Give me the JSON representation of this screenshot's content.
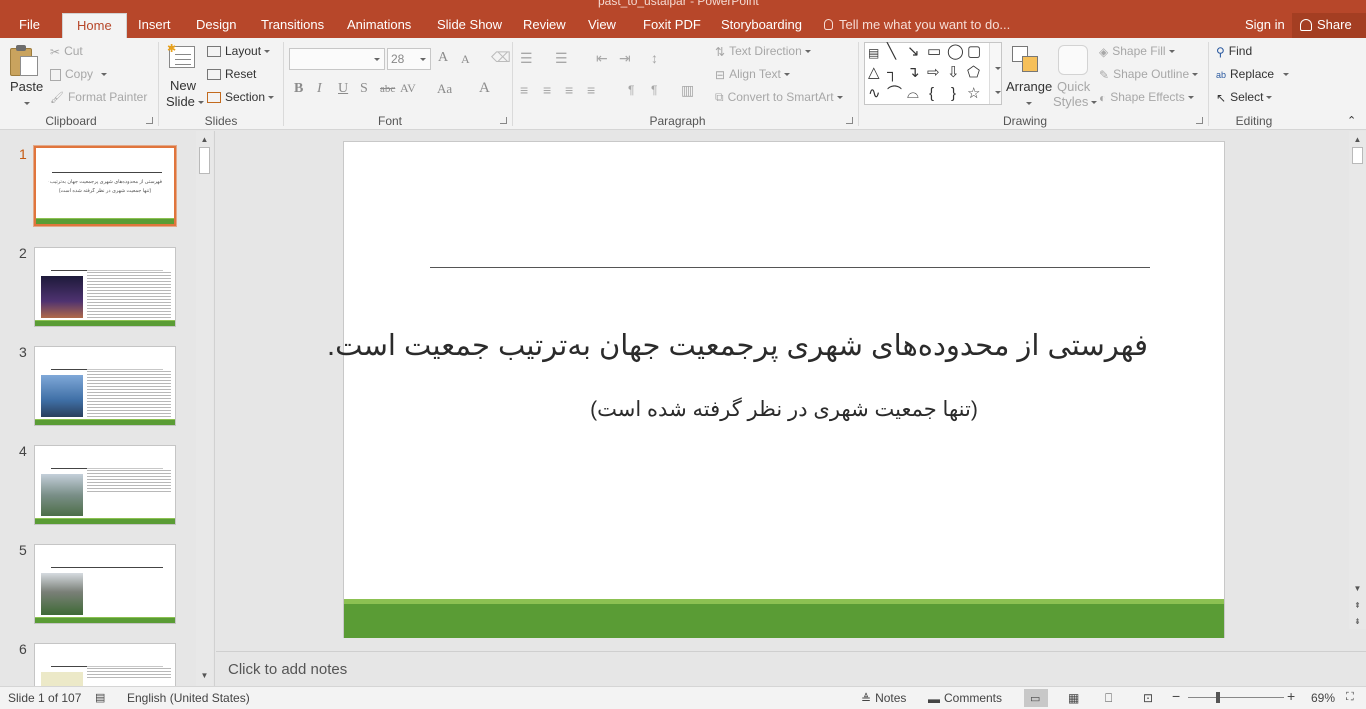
{
  "window": {
    "title": "past_to_ustaipar - PowerPoint"
  },
  "tabs": [
    {
      "label": "File",
      "active": false
    },
    {
      "label": "Home",
      "active": true
    },
    {
      "label": "Insert",
      "active": false
    },
    {
      "label": "Design",
      "active": false
    },
    {
      "label": "Transitions",
      "active": false
    },
    {
      "label": "Animations",
      "active": false
    },
    {
      "label": "Slide Show",
      "active": false
    },
    {
      "label": "Review",
      "active": false
    },
    {
      "label": "View",
      "active": false
    },
    {
      "label": "Foxit PDF",
      "active": false
    },
    {
      "label": "Storyboarding",
      "active": false
    }
  ],
  "tell_me": "Tell me what you want to do...",
  "sign_in": "Sign in",
  "share": "Share",
  "clipboard": {
    "group": "Clipboard",
    "paste": "Paste",
    "cut": "Cut",
    "copy": "Copy",
    "format_painter": "Format Painter"
  },
  "slides_group": {
    "group": "Slides",
    "new_slide_1": "New",
    "new_slide_2": "Slide",
    "layout": "Layout",
    "reset": "Reset",
    "section": "Section"
  },
  "font": {
    "group": "Font",
    "name": "",
    "size": "28",
    "bold": "B",
    "italic": "I",
    "underline": "U",
    "shadow": "S",
    "strike": "abc",
    "spacing": "AV",
    "case": "Aa",
    "color": "A",
    "grow": "A",
    "shrink": "A"
  },
  "paragraph": {
    "group": "Paragraph",
    "text_direction": "Text Direction",
    "align_text": "Align Text",
    "convert_smartart": "Convert to SmartArt"
  },
  "drawing": {
    "group": "Drawing",
    "arrange": "Arrange",
    "quick_styles_1": "Quick",
    "quick_styles_2": "Styles",
    "shape_fill": "Shape Fill",
    "shape_outline": "Shape Outline",
    "shape_effects": "Shape Effects"
  },
  "editing": {
    "group": "Editing",
    "find": "Find",
    "replace": "Replace",
    "select": "Select"
  },
  "thumbnails": [
    {
      "num": "1",
      "active": true,
      "line1": "فهرستی از محدوده‌های شهری پرجمعیت جهان به‌ترتیب جمعیت است.",
      "line2": "(تنها جمعیت شهری در نظر گرفته شده است)"
    },
    {
      "num": "2",
      "active": false,
      "photo_color": "#3a2a55"
    },
    {
      "num": "3",
      "active": false,
      "photo_color": "#3f6fa6"
    },
    {
      "num": "4",
      "active": false,
      "photo_color": "#6d8a6a"
    },
    {
      "num": "5",
      "active": false,
      "photo_color": "#4d6e48"
    },
    {
      "num": "6",
      "active": false,
      "photo_color": "#c9c48a"
    }
  ],
  "slide": {
    "title": "فهرستی از محدوده‌های شهری پرجمعیت جهان به‌ترتیب جمعیت است.",
    "subtitle": "(تنها جمعیت شهری در نظر گرفته شده است)"
  },
  "notes_placeholder": "Click to add notes",
  "status": {
    "slide_info": "Slide 1 of 107",
    "language": "English (United States)",
    "notes": "Notes",
    "comments": "Comments",
    "zoom": "69%"
  },
  "colors": {
    "accent": "#b7472a",
    "slide_band": "#5a9c35",
    "slide_band_light": "#8cc152",
    "active_thumb_border": "#e0753d"
  }
}
